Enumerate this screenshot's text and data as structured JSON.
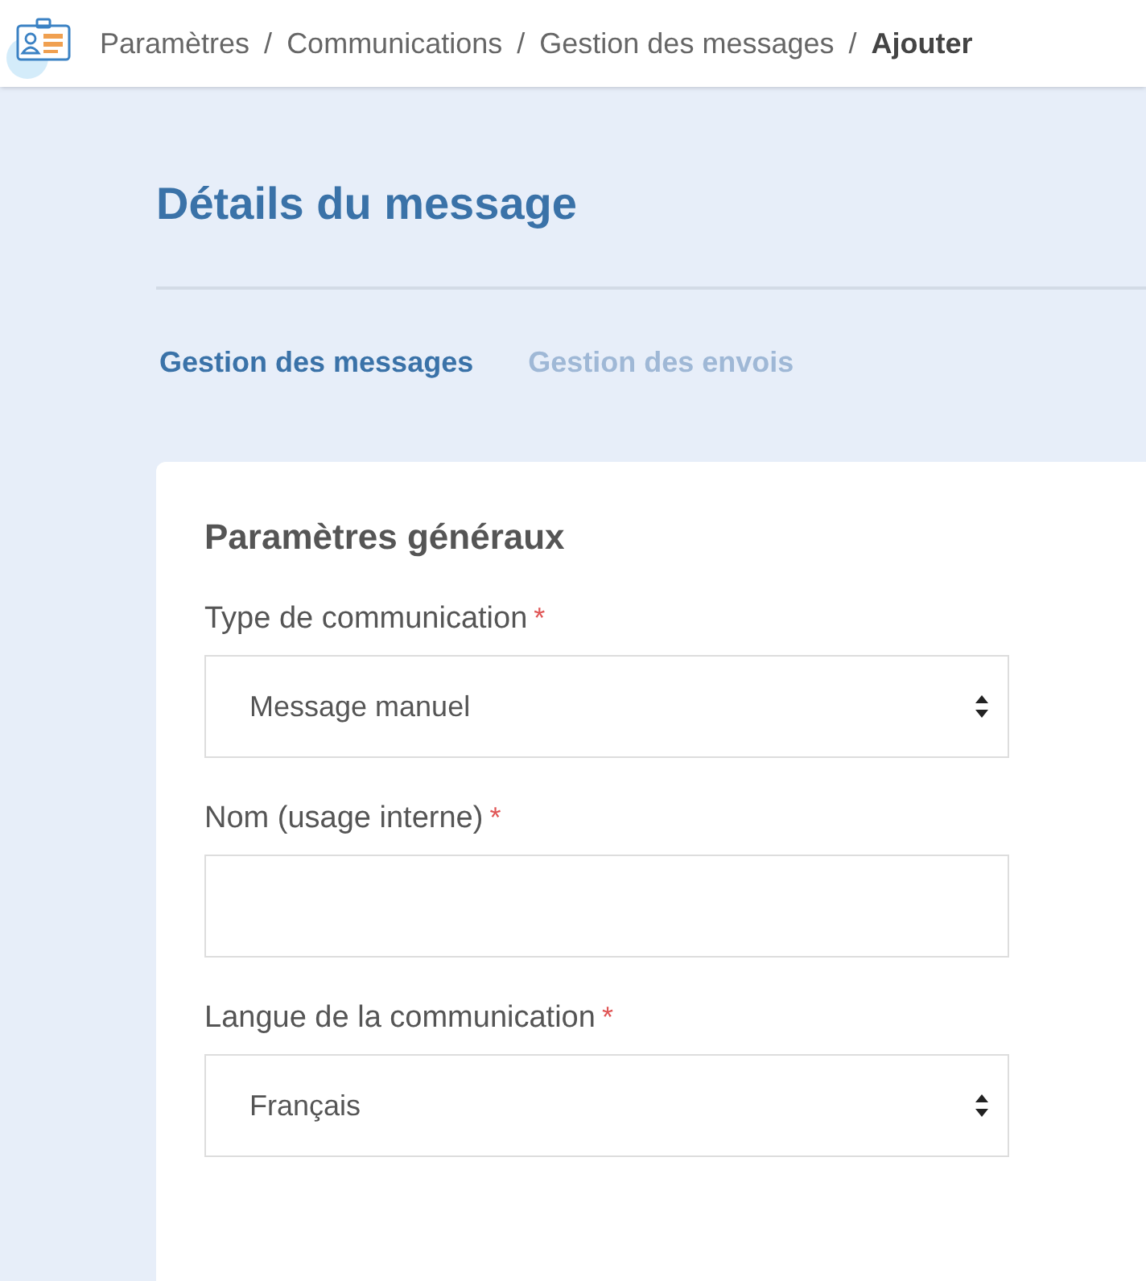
{
  "breadcrumb": [
    {
      "kind": "link",
      "text": "Paramètres"
    },
    {
      "kind": "separator",
      "text": "/"
    },
    {
      "kind": "link",
      "text": "Communications"
    },
    {
      "kind": "separator",
      "text": "/"
    },
    {
      "kind": "link",
      "text": "Gestion des messages"
    },
    {
      "kind": "separator",
      "text": "/"
    },
    {
      "kind": "current",
      "text": "Ajouter"
    }
  ],
  "page_title": "Détails du message",
  "tabs": [
    {
      "label": "Gestion des messages",
      "selected": true
    },
    {
      "label": "Gestion des envois",
      "selected": false
    }
  ],
  "card": {
    "title": "Paramètres généraux",
    "fields": [
      {
        "kind": "select",
        "label": "Type de communication",
        "required_mark": "*",
        "value": "Message manuel"
      },
      {
        "kind": "text",
        "label": "Nom (usage interne)",
        "required_mark": "*"
      },
      {
        "kind": "select",
        "label": "Langue de la communication",
        "required_mark": "*",
        "value": "Français"
      }
    ]
  }
}
